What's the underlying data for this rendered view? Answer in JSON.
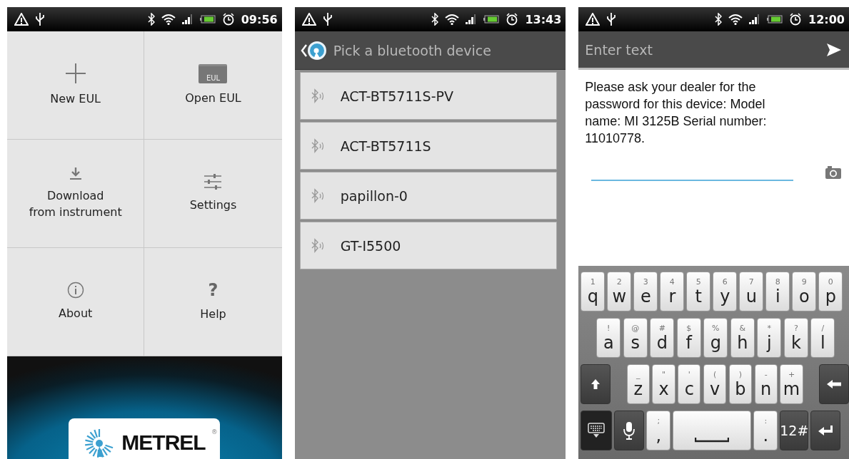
{
  "screens": [
    {
      "kind": "menu",
      "status_bar": {
        "time": "09:56"
      },
      "tiles": [
        {
          "kind": "plus",
          "label": "New EUL"
        },
        {
          "kind": "folder",
          "label": "Open EUL",
          "icon_text": "EUL"
        },
        {
          "kind": "download",
          "label": "Download\nfrom instrument"
        },
        {
          "kind": "sliders",
          "label": "Settings"
        },
        {
          "kind": "info",
          "label": "About"
        },
        {
          "kind": "help",
          "label": "Help",
          "glyph": "?"
        }
      ],
      "logo": {
        "text": "METREL",
        "mark": "®"
      }
    },
    {
      "kind": "list",
      "status_bar": {
        "time": "13:43"
      },
      "title": "Pick a bluetooth device",
      "devices": [
        {
          "name": "ACT-BT5711S-PV"
        },
        {
          "name": "ACT-BT5711S"
        },
        {
          "name": "papillon-0"
        },
        {
          "name": "GT-I5500"
        }
      ]
    },
    {
      "kind": "prompt",
      "status_bar": {
        "time": "12:00"
      },
      "title": "Enter text",
      "message": "Please ask your dealer for the password for this device: Model name: MI 3125B Serial number: 11010778.",
      "keyboard": [
        [
          {
            "kind": "char",
            "alt": "1",
            "main": "q"
          },
          {
            "kind": "char",
            "alt": "2",
            "main": "w"
          },
          {
            "kind": "char",
            "alt": "3",
            "main": "e"
          },
          {
            "kind": "char",
            "alt": "4",
            "main": "r"
          },
          {
            "kind": "char",
            "alt": "5",
            "main": "t"
          },
          {
            "kind": "char",
            "alt": "6",
            "main": "y"
          },
          {
            "kind": "char",
            "alt": "7",
            "main": "u"
          },
          {
            "kind": "char",
            "alt": "8",
            "main": "i"
          },
          {
            "kind": "char",
            "alt": "9",
            "main": "o"
          },
          {
            "kind": "char",
            "alt": "0",
            "main": "p"
          }
        ],
        [
          {
            "kind": "char",
            "alt": "!",
            "main": "a"
          },
          {
            "kind": "char",
            "alt": "@",
            "main": "s"
          },
          {
            "kind": "char",
            "alt": "#",
            "main": "d"
          },
          {
            "kind": "char",
            "alt": "$",
            "main": "f"
          },
          {
            "kind": "char",
            "alt": "%",
            "main": "g"
          },
          {
            "kind": "char",
            "alt": "&",
            "main": "h"
          },
          {
            "kind": "char",
            "alt": "*",
            "main": "j"
          },
          {
            "kind": "char",
            "alt": "?",
            "main": "k"
          },
          {
            "kind": "char",
            "alt": "/",
            "main": "l"
          }
        ],
        [
          {
            "kind": "shift"
          },
          {
            "kind": "char",
            "alt": "_",
            "main": "z"
          },
          {
            "kind": "char",
            "alt": "\"",
            "main": "x"
          },
          {
            "kind": "char",
            "alt": "'",
            "main": "c"
          },
          {
            "kind": "char",
            "alt": "(",
            "main": "v"
          },
          {
            "kind": "char",
            "alt": ")",
            "main": "b"
          },
          {
            "kind": "char",
            "alt": "-",
            "main": "n"
          },
          {
            "kind": "char",
            "alt": "+",
            "main": "m"
          },
          {
            "kind": "backspace"
          }
        ],
        [
          {
            "kind": "hide"
          },
          {
            "kind": "mic"
          },
          {
            "kind": "char",
            "alt": ";",
            "main": ","
          },
          {
            "kind": "space"
          },
          {
            "kind": "char",
            "alt": ":",
            "main": "."
          },
          {
            "kind": "label",
            "main": "12#"
          },
          {
            "kind": "enter"
          }
        ]
      ]
    }
  ]
}
